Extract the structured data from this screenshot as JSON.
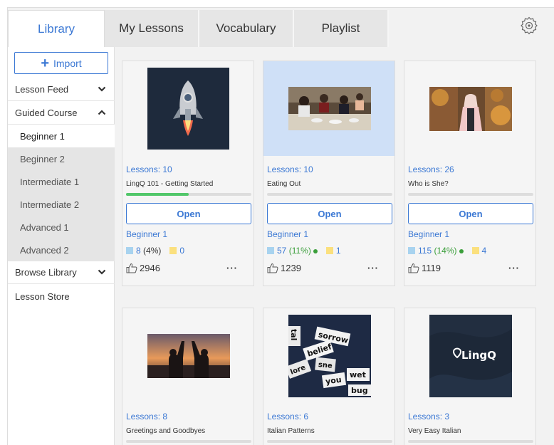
{
  "tabs": [
    {
      "label": "Library",
      "active": true
    },
    {
      "label": "My Lessons"
    },
    {
      "label": "Vocabulary"
    },
    {
      "label": "Playlist"
    }
  ],
  "sidebar": {
    "import_label": "Import",
    "lesson_feed": "Lesson Feed",
    "guided_course": "Guided Course",
    "levels": [
      "Beginner 1",
      "Beginner 2",
      "Intermediate 1",
      "Intermediate 2",
      "Advanced 1",
      "Advanced 2"
    ],
    "browse_library": "Browse Library",
    "lesson_store": "Lesson Store"
  },
  "cards": [
    {
      "lessons": "Lessons: 10",
      "title": "LingQ 101 - Getting Started",
      "progress": 0.5,
      "open": "Open",
      "level": "Beginner 1",
      "blue_count": "8",
      "blue_pct": "(4%)",
      "yellow_count": "0",
      "likes": "2946",
      "more": "···"
    },
    {
      "lessons": "Lessons: 10",
      "title": "Eating Out",
      "progress": 0,
      "open": "Open",
      "level": "Beginner 1",
      "blue_count": "57",
      "blue_pct": "(11%)",
      "yellow_count": "1",
      "likes": "1239",
      "more": "···"
    },
    {
      "lessons": "Lessons: 26",
      "title": "Who is She?",
      "progress": 0,
      "open": "Open",
      "level": "Beginner 1",
      "blue_count": "115",
      "blue_pct": "(14%)",
      "yellow_count": "4",
      "likes": "1119",
      "more": "···"
    },
    {
      "lessons": "Lessons: 8",
      "title": "Greetings and Goodbyes"
    },
    {
      "lessons": "Lessons: 6",
      "title": "Italian Patterns",
      "word_tiles": [
        "sorrow",
        "tal",
        "belief",
        "wet",
        "you",
        "bug",
        "sne",
        "lore"
      ]
    },
    {
      "lessons": "Lessons: 3",
      "title": "Very Easy Italian",
      "logo": "LingQ"
    }
  ],
  "colors": {
    "accent": "#3b78d4",
    "progress": "#52c76a",
    "known_square": "#a8d3ef",
    "lingq_square": "#fbe07e"
  }
}
